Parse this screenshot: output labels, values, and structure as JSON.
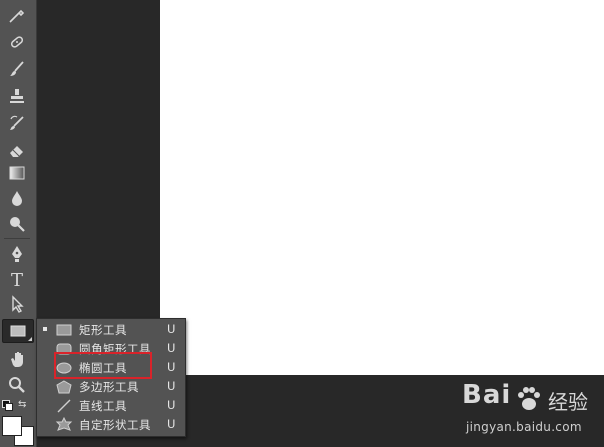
{
  "toolbar": {
    "tools": [
      {
        "name": "eyedropper-icon"
      },
      {
        "name": "healing-brush-icon"
      },
      {
        "name": "brush-icon"
      },
      {
        "name": "clone-stamp-icon"
      },
      {
        "name": "history-brush-icon"
      },
      {
        "name": "eraser-icon"
      },
      {
        "name": "gradient-icon"
      },
      {
        "name": "blur-icon"
      },
      {
        "name": "dodge-icon"
      },
      {
        "name": "pen-icon"
      },
      {
        "name": "type-icon",
        "glyph": "T"
      },
      {
        "name": "path-selection-icon"
      },
      {
        "name": "rectangle-tool-icon"
      },
      {
        "name": "hand-icon"
      },
      {
        "name": "zoom-icon"
      }
    ]
  },
  "flyout": {
    "items": [
      {
        "label": "矩形工具",
        "shortcut": "U",
        "selected": true,
        "icon": "rectangle-icon"
      },
      {
        "label": "圆角矩形工具",
        "shortcut": "U",
        "selected": false,
        "icon": "rounded-rectangle-icon"
      },
      {
        "label": "椭圆工具",
        "shortcut": "U",
        "selected": false,
        "icon": "ellipse-icon"
      },
      {
        "label": "多边形工具",
        "shortcut": "U",
        "selected": false,
        "icon": "polygon-icon"
      },
      {
        "label": "直线工具",
        "shortcut": "U",
        "selected": false,
        "icon": "line-icon"
      },
      {
        "label": "自定形状工具",
        "shortcut": "U",
        "selected": false,
        "icon": "custom-shape-icon"
      }
    ]
  },
  "highlight": {
    "color": "#d9232a",
    "target": "椭圆工具"
  },
  "watermark": {
    "logo": "Bai",
    "logo_suffix": "经验",
    "url": "jingyan.baidu.com"
  },
  "colors": {
    "toolbar_bg": "#535353",
    "workspace_dark": "#282828",
    "canvas": "#ffffff",
    "menu_text": "#e6e6e6"
  }
}
